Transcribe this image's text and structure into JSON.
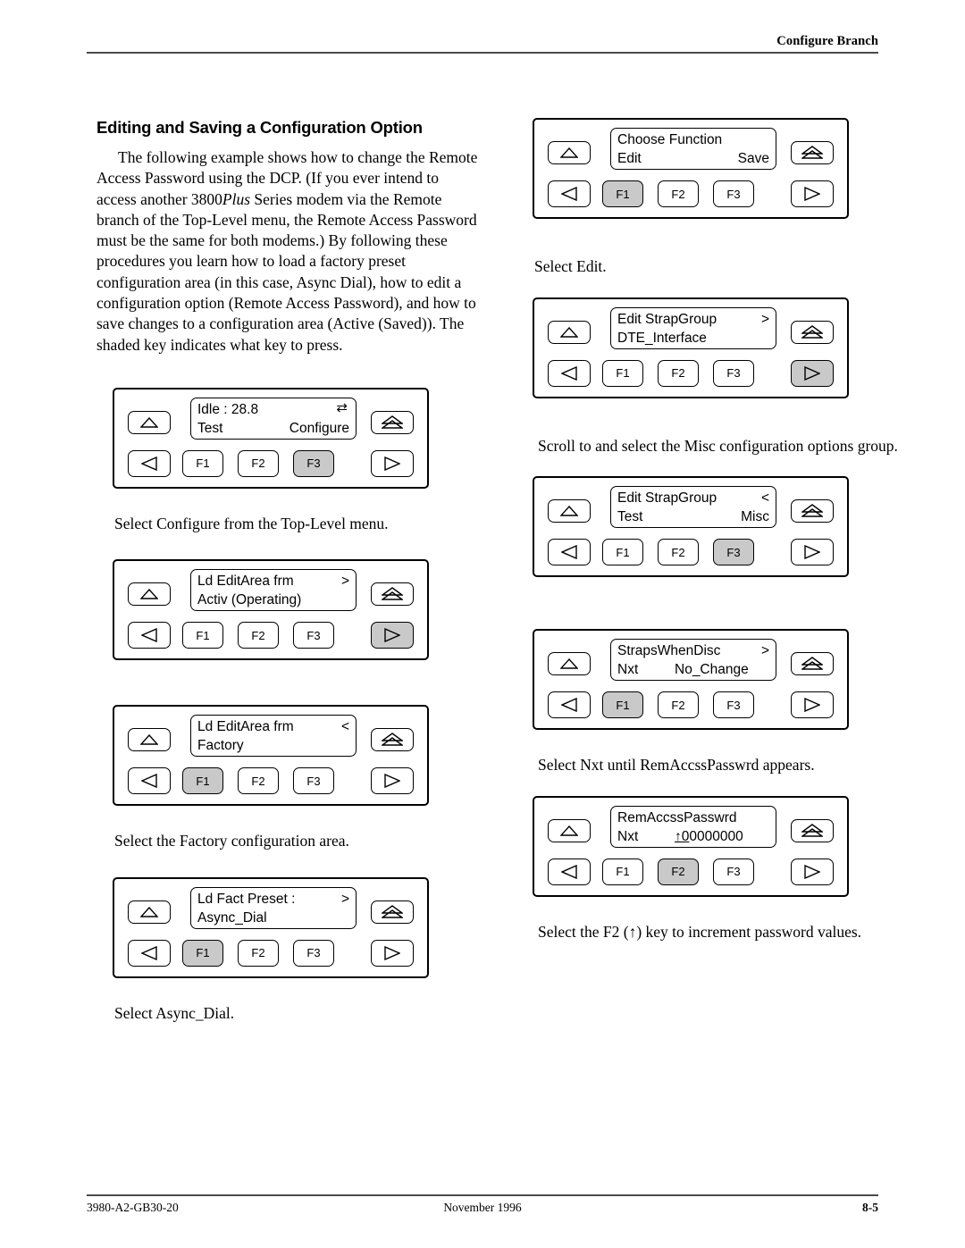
{
  "page": {
    "running_header": "Configure Branch",
    "footer": {
      "doc_number": "3980-A2-GB30-20",
      "date": "November 1996",
      "page_number": "8-5"
    }
  },
  "section": {
    "title": "Editing and Saving a Configuration Option",
    "intro_part1": "The following example shows how to change the Remote Access Password using the DCP. (If you ever intend to access another 3800",
    "intro_italic": "Plus",
    "intro_part2": " Series modem via the Remote branch of the Top-Level menu, the Remote Access Password must be the same for both modems.) By following these procedures you learn how to load a factory preset configuration area (in this case, Async Dial), how to edit a configuration option (Remote Access Password), and how to save changes to a configuration area (Active (Saved)). The shaded key indicates what key to press."
  },
  "keys": {
    "f1": "F1",
    "f2": "F2",
    "f3": "F3",
    "up_icon": "triangle-up-icon",
    "home_icon": "double-triangle-up-icon",
    "left_icon": "triangle-left-icon",
    "right_icon": "triangle-right-icon"
  },
  "panels": [
    {
      "id": "panel-idle",
      "line1_left": "Idle : 28.8",
      "line1_right": "",
      "line1_marker": "⇄",
      "line2_left": "Test",
      "line2_right": "Configure",
      "shaded_key": "f3"
    },
    {
      "id": "panel-ld-editarea-activ",
      "line1_left": "Ld EditArea frm",
      "line1_right": ">",
      "line1_marker": "",
      "line2_left": "Activ (Operating)",
      "line2_right": "",
      "shaded_key": "right"
    },
    {
      "id": "panel-ld-editarea-factory",
      "line1_left": "Ld EditArea frm",
      "line1_right": "<",
      "line1_marker": "",
      "line2_left": "Factory",
      "line2_right": "",
      "shaded_key": "f1"
    },
    {
      "id": "panel-ld-fact-preset",
      "line1_left": "Ld Fact Preset :",
      "line1_right": ">",
      "line1_marker": "",
      "line2_left": "Async_Dial",
      "line2_right": "",
      "shaded_key": "f1"
    },
    {
      "id": "panel-choose-function",
      "line1_left": "Choose Function",
      "line1_right": "",
      "line1_marker": "",
      "line2_left": "Edit",
      "line2_right": "Save",
      "shaded_key": "f1"
    },
    {
      "id": "panel-edit-strapgroup-dte",
      "line1_left": "Edit StrapGroup",
      "line1_right": ">",
      "line1_marker": "",
      "line2_left": "DTE_Interface",
      "line2_right": "",
      "shaded_key": "right"
    },
    {
      "id": "panel-edit-strapgroup-misc",
      "line1_left": "Edit StrapGroup",
      "line1_right": "<",
      "line1_marker": "",
      "line2_left": "Test",
      "line2_right": "Misc",
      "shaded_key": "f3"
    },
    {
      "id": "panel-straps-when-disc",
      "line1_left": "StrapsWhenDisc",
      "line1_right": ">",
      "line1_marker": "",
      "line2_left": "Nxt",
      "line2_center": "No_Change",
      "line2_right": "",
      "shaded_key": "f1"
    },
    {
      "id": "panel-rem-accss-passwrd",
      "line1_left": "RemAccssPasswrd",
      "line1_right": "",
      "line1_marker": "",
      "line2_left": "Nxt",
      "line2_center": "↑0",
      "line2_center_rest": "0000000",
      "line2_right": "",
      "shaded_key": "f2"
    }
  ],
  "captions": {
    "select_configure": "Select Configure from the Top-Level menu.",
    "select_factory": "Select the Factory configuration area.",
    "select_async_dial": "Select Async_Dial.",
    "select_edit": "Select Edit.",
    "scroll_misc": "Scroll to and select the Misc configuration options group.",
    "select_nxt": "Select Nxt until RemAccssPasswrd appears.",
    "select_f2": "Select the F2 (↑) key to increment password values."
  }
}
